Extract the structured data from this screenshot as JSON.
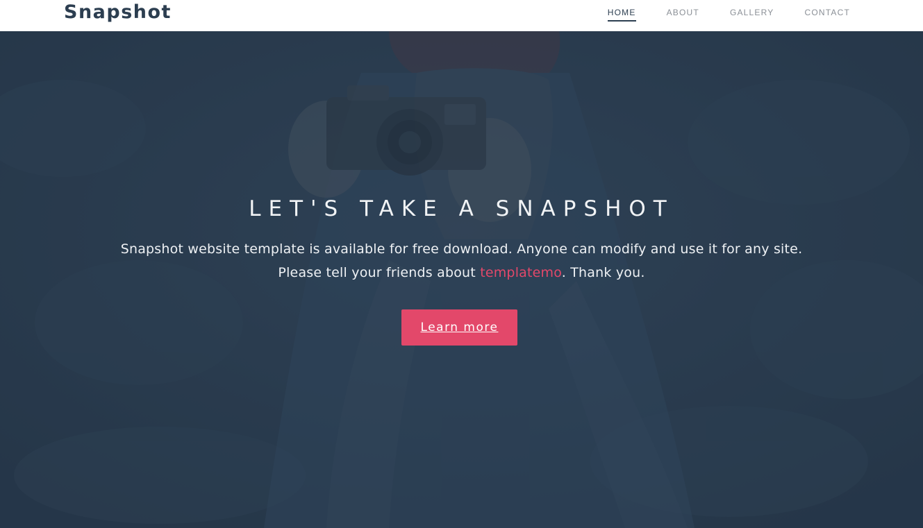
{
  "brand": {
    "name": "Snapshot"
  },
  "nav": {
    "items": [
      {
        "label": "HOME",
        "active": true
      },
      {
        "label": "ABOUT",
        "active": false
      },
      {
        "label": "GALLERY",
        "active": false
      },
      {
        "label": "CONTACT",
        "active": false
      }
    ]
  },
  "hero": {
    "title": "LET'S TAKE A SNAPSHOT",
    "line1": "Snapshot website template is available for free download. Anyone can modify and use it for any site.",
    "line2_before": "Please tell your friends about ",
    "line2_link": "templatemo",
    "line2_after": ". Thank you.",
    "button_label": "Learn more"
  },
  "colors": {
    "primary": "#2c3e50",
    "accent": "#e3486a",
    "overlay": "#2a3b4f"
  },
  "icons": {
    "hero_image": "photographer-with-camera-image"
  }
}
